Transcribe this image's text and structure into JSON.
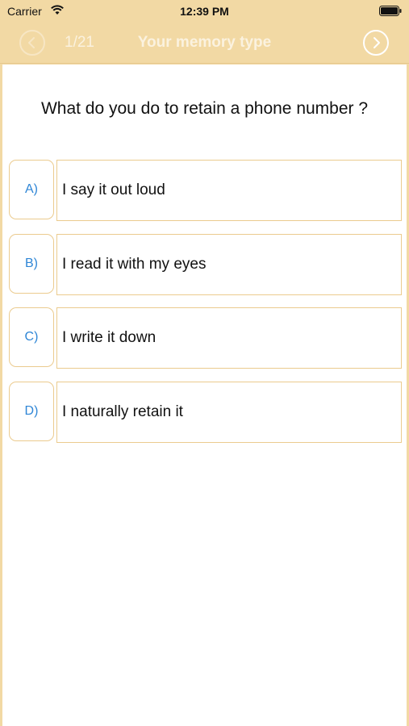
{
  "status_bar": {
    "carrier": "Carrier",
    "time": "12:39 PM"
  },
  "nav": {
    "counter": "1/21",
    "title": "Your memory type",
    "back_icon": "chevron-left-circle-icon",
    "forward_icon": "chevron-right-circle-icon"
  },
  "question": "What do you do to retain a phone number ?",
  "options": [
    {
      "letter": "A)",
      "text": "I say it out loud"
    },
    {
      "letter": "B)",
      "text": "I read it with my eyes"
    },
    {
      "letter": "C)",
      "text": "I write it down"
    },
    {
      "letter": "D)",
      "text": "I naturally retain it"
    }
  ],
  "colors": {
    "header_bg": "#f2d9a4",
    "border": "#ebcb8e",
    "letter_text": "#2f86d6",
    "header_text": "#fbf2df"
  }
}
